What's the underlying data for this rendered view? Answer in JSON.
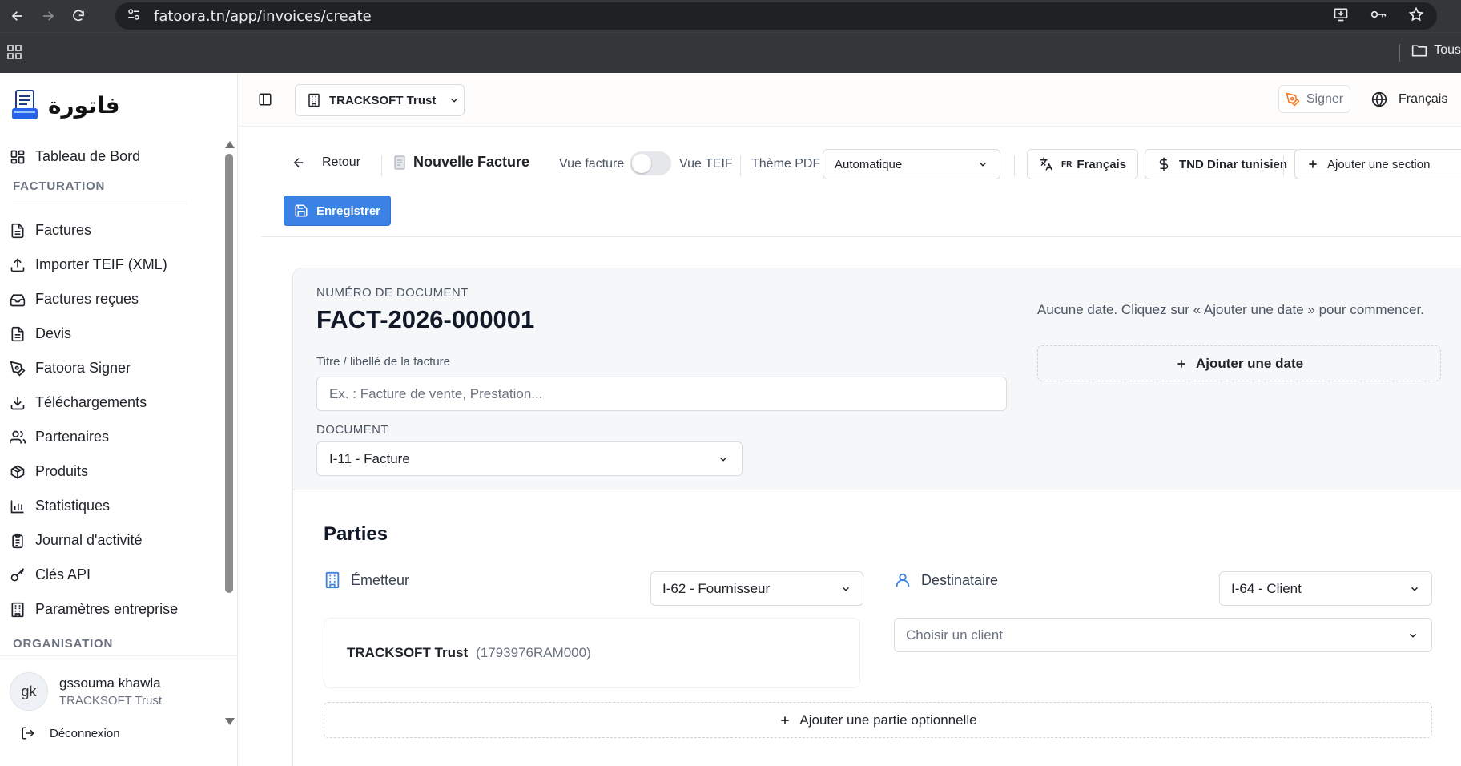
{
  "browser": {
    "url": "fatoora.tn/app/invoices/create",
    "bookmarks_all": "Tous"
  },
  "sidebar": {
    "logo_text": "فاتورة",
    "items_top": [
      {
        "label": "Tableau de Bord",
        "icon": "dashboard-icon"
      }
    ],
    "section_facturation": "FACTURATION",
    "items_facturation": [
      {
        "label": "Factures",
        "icon": "file-icon"
      },
      {
        "label": "Importer TEIF (XML)",
        "icon": "upload-icon"
      },
      {
        "label": "Factures reçues",
        "icon": "inbox-icon"
      },
      {
        "label": "Devis",
        "icon": "file-icon"
      },
      {
        "label": "Fatoora Signer",
        "icon": "signature-icon"
      },
      {
        "label": "Téléchargements",
        "icon": "download-icon"
      },
      {
        "label": "Partenaires",
        "icon": "users-icon"
      },
      {
        "label": "Produits",
        "icon": "package-icon"
      },
      {
        "label": "Statistiques",
        "icon": "chart-icon"
      },
      {
        "label": "Journal d'activité",
        "icon": "clipboard-icon"
      },
      {
        "label": "Clés API",
        "icon": "key-icon"
      },
      {
        "label": "Paramètres entreprise",
        "icon": "building-icon"
      }
    ],
    "section_organisation": "ORGANISATION",
    "user": {
      "initials": "gk",
      "name": "gssouma khawla",
      "org": "TRACKSOFT Trust"
    },
    "logout_label": "Déconnexion"
  },
  "header": {
    "company": "TRACKSOFT Trust",
    "signer_label": "Signer",
    "language": "Français"
  },
  "toolbar": {
    "back_label": "Retour",
    "title": "Nouvelle Facture",
    "vue_facture": "Vue facture",
    "vue_teif": "Vue TEIF",
    "theme_label": "Thème PDF",
    "theme_value": "Automatique",
    "lang_code": "FR",
    "lang_label": "Français",
    "currency_label": "TND Dinar tunisien",
    "add_section_label": "Ajouter une section",
    "save_label": "Enregistrer"
  },
  "document": {
    "number_label": "NUMÉRO DE DOCUMENT",
    "number": "FACT-2026-000001",
    "title_label": "Titre / libellé de la facture",
    "title_placeholder": "Ex. : Facture de vente, Prestation...",
    "type_label": "DOCUMENT",
    "type_value": "I-11 - Facture",
    "no_date_text": "Aucune date. Cliquez sur « Ajouter une date » pour commencer.",
    "add_date_label": "Ajouter une date"
  },
  "parties": {
    "title": "Parties",
    "emitter_label": "Émetteur",
    "emitter_role": "I-62 - Fournisseur",
    "emitter_name": "TRACKSOFT Trust",
    "emitter_id": "(1793976RAM000)",
    "recipient_label": "Destinataire",
    "recipient_role": "I-64 - Client",
    "client_placeholder": "Choisir un client",
    "add_optional_label": "Ajouter une partie optionnelle"
  },
  "colors": {
    "primary": "#3a82e4",
    "accent_orange": "#f97316"
  }
}
